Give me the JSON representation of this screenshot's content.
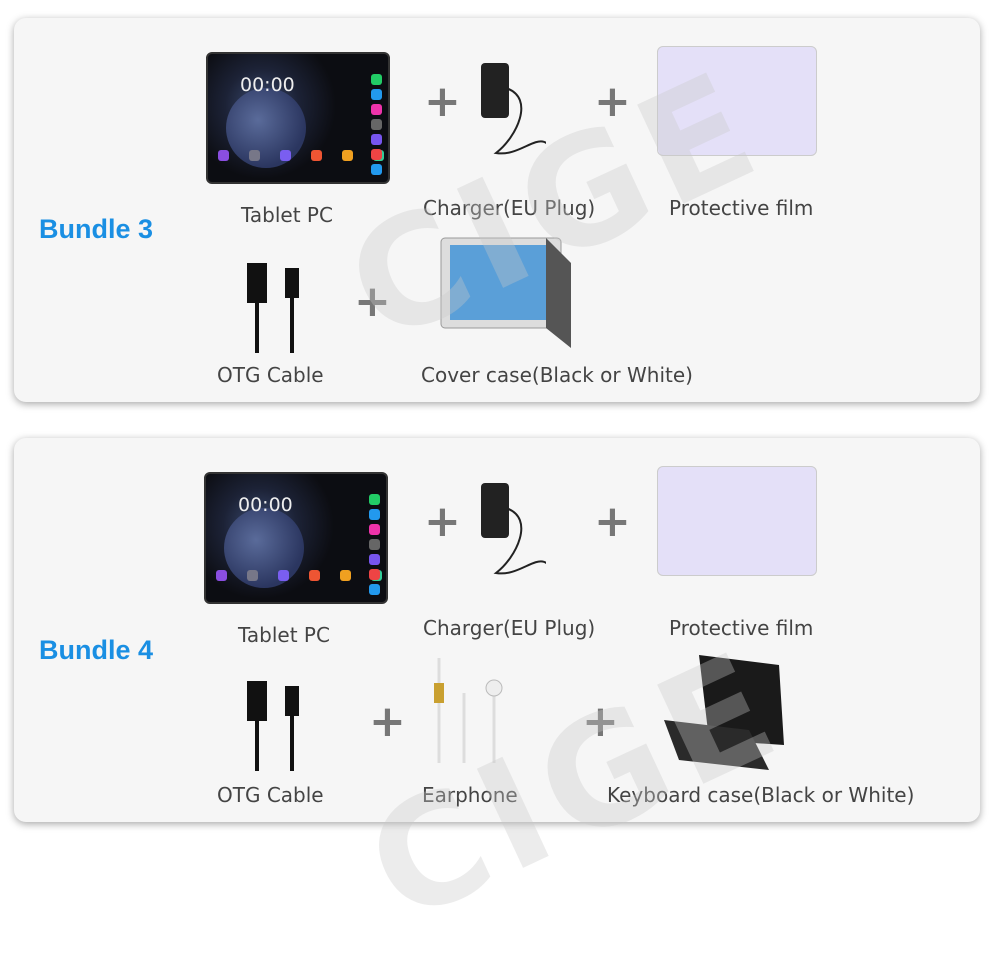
{
  "watermark": "CIGE",
  "bundles": [
    {
      "title": "Bundle 3",
      "items": {
        "tablet": "Tablet PC",
        "charger": "Charger(EU Plug)",
        "film": "Protective film",
        "otg": "OTG Cable",
        "extra1": "Cover case(Black or White)"
      },
      "tablet_time": "00:00"
    },
    {
      "title": "Bundle 4",
      "items": {
        "tablet": "Tablet PC",
        "charger": "Charger(EU Plug)",
        "film": "Protective film",
        "otg": "OTG Cable",
        "extra1": "Earphone",
        "extra2": "Keyboard case(Black or White)"
      },
      "tablet_time": "00:00"
    }
  ],
  "plus_sign": "+",
  "colors": {
    "accent": "#1a8fe3",
    "card": "#f6f6f6"
  }
}
